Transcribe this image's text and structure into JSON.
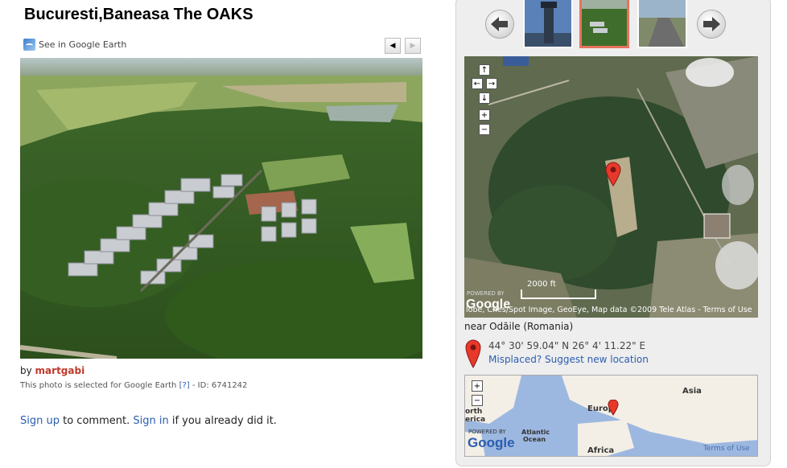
{
  "photo": {
    "title": "Bucuresti,Baneasa The OAKS",
    "google_earth_link": "See in Google Earth",
    "prev_icon": "triangle-left",
    "next_icon": "triangle-right"
  },
  "attribution": {
    "by_label": "by",
    "author": "martgabi",
    "ge_note_prefix": "This photo is selected for Google Earth",
    "help_link": "[?]",
    "id_label": "- ID: 6741242"
  },
  "comment": {
    "sign_up": "Sign up",
    "to_comment": "to comment.",
    "sign_in": "Sign in",
    "already": "if you already did it."
  },
  "map": {
    "scale": "2000 ft",
    "powered_by": "POWERED BY",
    "logo": "Google",
    "attribution": "lobe, Cnes/Spot Image, GeoEye, Map data ©2009 Tele Atlas - Terms of Use",
    "controls": [
      "↑",
      "←",
      "→",
      "↓",
      "+",
      "−"
    ]
  },
  "location": {
    "near": "near Odăile (Romania)",
    "coordinates": "44° 30' 59.04\" N 26° 4' 11.22\" E",
    "misplaced": "Misplaced? Suggest new location"
  },
  "world_map": {
    "labels": [
      "Asia",
      "Europ",
      "orth",
      "erica",
      "Atlantic",
      "Ocean",
      "Africa"
    ],
    "powered_by": "POWERED BY",
    "logo": "Google",
    "terms": "Terms of Use",
    "zoom_in": "+",
    "zoom_out": "−"
  },
  "colors": {
    "link": "#2a5db0",
    "author": "#c0392b",
    "selected_thumb": "#e6735e",
    "panel_bg": "#eeeeee"
  }
}
